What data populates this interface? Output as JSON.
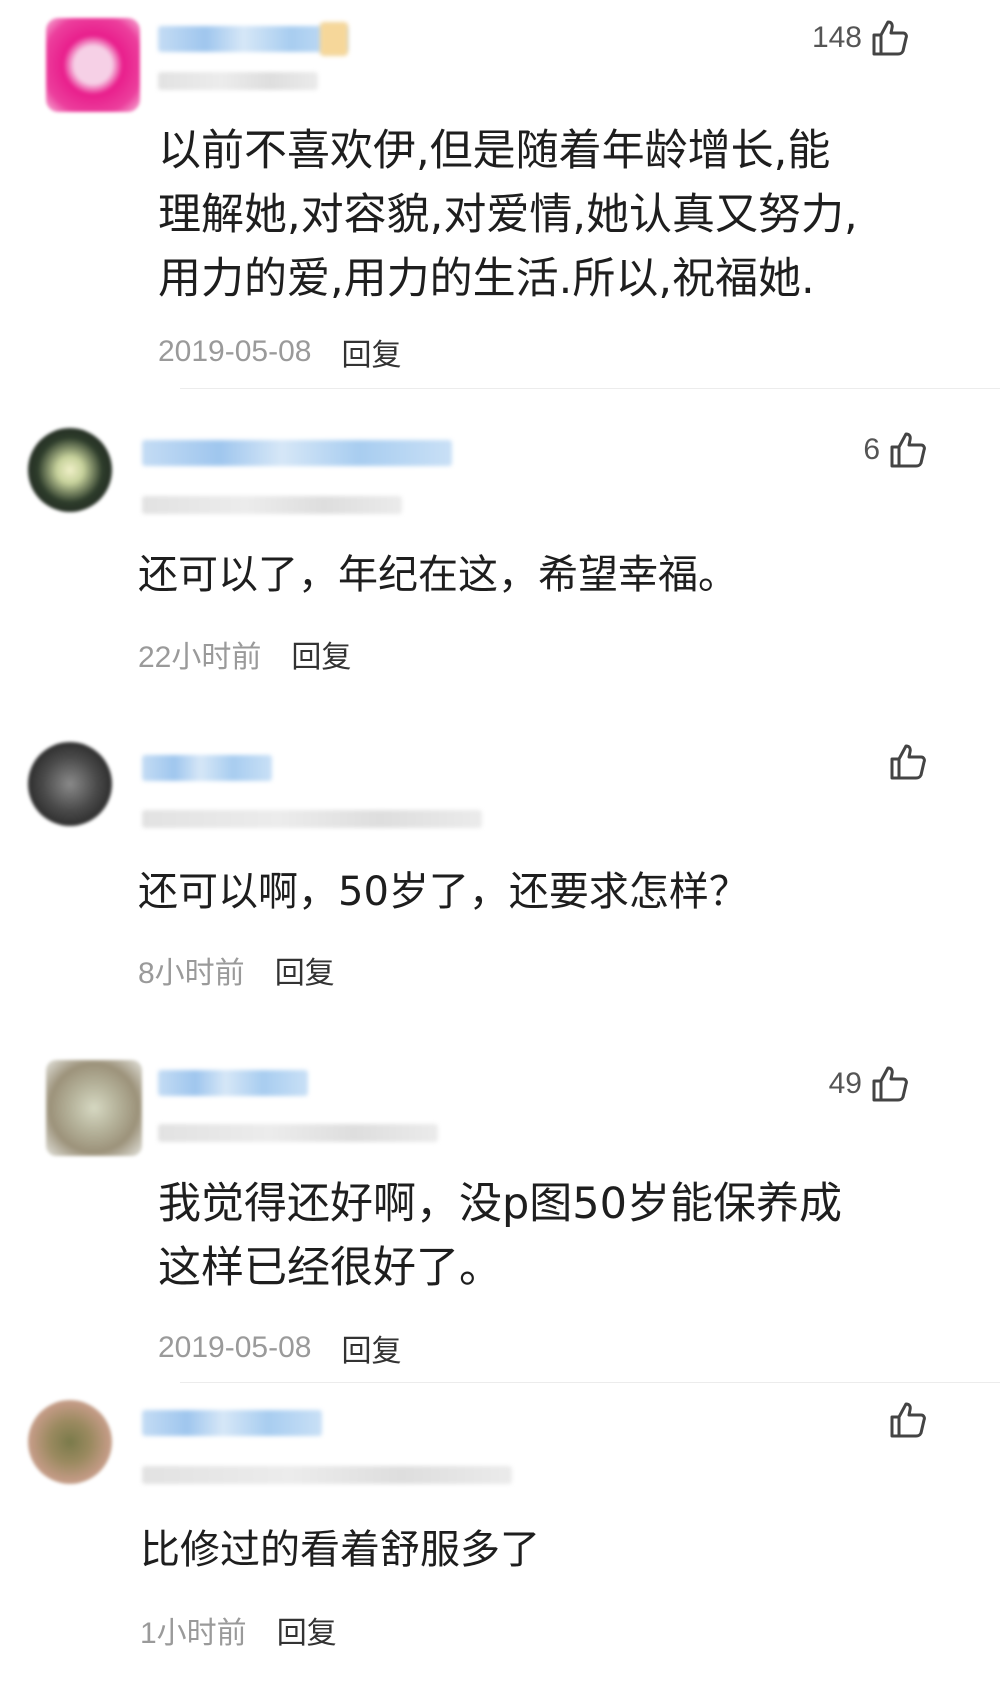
{
  "comments": [
    {
      "likes": "148",
      "lines": [
        "以前不喜欢伊,但是随着年龄增长,能",
        "理解她,对容貌,对爱情,她认真又努力,",
        "用力的爱,用力的生活.所以,祝福她."
      ],
      "time": "2019-05-08",
      "reply": "回复",
      "avatar_color": "#e91e8c"
    },
    {
      "likes": "6",
      "lines": [
        "还可以了，年纪在这，希望幸福。"
      ],
      "time": "22小时前",
      "reply": "回复",
      "avatar_color": "#3b4a3a"
    },
    {
      "likes": "",
      "lines": [
        "还可以啊，50岁了，还要求怎样？"
      ],
      "time": "8小时前",
      "reply": "回复",
      "avatar_color": "#555555"
    },
    {
      "likes": "49",
      "lines": [
        "我觉得还好啊，没p图50岁能保养成",
        "这样已经很好了。"
      ],
      "time": "2019-05-08",
      "reply": "回复",
      "avatar_color": "#a9a48e"
    },
    {
      "likes": "",
      "lines": [
        "比修过的看着舒服多了"
      ],
      "time": "1小时前",
      "reply": "回复",
      "avatar_color": "#8a7d5e"
    }
  ]
}
